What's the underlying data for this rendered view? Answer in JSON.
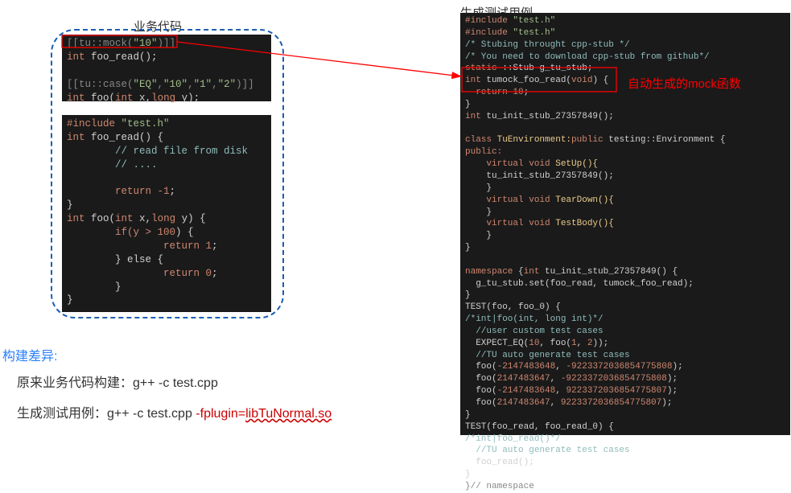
{
  "titles": {
    "left": "业务代码",
    "right": "生成测试用例"
  },
  "labels": {
    "mock_fn": "自动生成的mock函数",
    "build_diff": "构建差异:",
    "build_line1_prefix": "原来业务代码构建：",
    "build_line1_cmd": "g++ -c test.cpp",
    "build_line2_prefix": "生成测试用例：",
    "build_line2_cmd": "g++ -c test.cpp ",
    "build_line2_plugin_a": "-fplugin=",
    "build_line2_plugin_b": "libTuNormal.so"
  },
  "code_top": {
    "l1a": "[[tu::mock(",
    "l1b": "\"10\"",
    "l1c": ")]]",
    "l2a": "int",
    "l2b": " foo_read();",
    "l3": "",
    "l4a": "[[tu::case(",
    "l4b": "\"EQ\"",
    "l4c": ",",
    "l4d": "\"10\"",
    "l4e": ",",
    "l4f": "\"1\"",
    "l4g": ",",
    "l4h": "\"2\"",
    "l4i": ")]]",
    "l5a": "int",
    "l5b": " foo(",
    "l5c": "int",
    "l5d": " x,",
    "l5e": "long",
    "l5f": " y);"
  },
  "code_mid": {
    "l1a": "#include ",
    "l1b": "\"test.h\"",
    "l2a": "int",
    "l2b": " foo_read() {",
    "l3": "        // read file from disk",
    "l4": "        // ....",
    "l5": "",
    "l6a": "        return ",
    "l6b": "-1",
    "l6c": ";",
    "l7": "}",
    "l8a": "int",
    "l8b": " foo(",
    "l8c": "int",
    "l8d": " x,",
    "l8e": "long",
    "l8f": " y) {",
    "l9a": "        if(y > ",
    "l9b": "100",
    "l9c": ") {",
    "l10a": "                return ",
    "l10b": "1",
    "l10c": ";",
    "l11": "        } else {",
    "l12a": "                return ",
    "l12b": "0",
    "l12c": ";",
    "l13": "        }",
    "l14": "}"
  },
  "code_right": {
    "l1a": "#include ",
    "l1b": "\"test.h\"",
    "l2a": "#include ",
    "l2b": "\"test.h\"",
    "l3": "/* Stubing throught cpp-stub */",
    "l4": "/* You need to download cpp-stub from github*/",
    "l5a": "static ",
    "l5b": "::Stub g_tu_stub;",
    "l6a": "int",
    "l6b": " tumock_foo_read(",
    "l6c": "void",
    "l6d": ") {",
    "l7a": "  return ",
    "l7b": "10",
    "l7c": ";",
    "l8": "}",
    "l9a": "int",
    "l9b": " tu_init_stub_27357849();",
    "l10": "",
    "l11a": "class ",
    "l11b": "TuEnvironment:",
    "l11c": "public ",
    "l11d": "testing::Environment {",
    "l12": "public:",
    "l13a": "    virtual void ",
    "l13b": "SetUp(){",
    "l14": "    tu_init_stub_27357849();",
    "l15": "    }",
    "l16a": "    virtual void ",
    "l16b": "TearDown(){",
    "l17": "    }",
    "l18a": "    virtual void ",
    "l18b": "TestBody(){",
    "l19": "    }",
    "l20": "}",
    "l21": "",
    "l22a": "namespace ",
    "l22b": "{",
    "l22c": "int",
    "l22d": " tu_init_stub_27357849() {",
    "l23": "  g_tu_stub.set(foo_read, tumock_foo_read);",
    "l24": "}",
    "l25": "TEST(foo, foo_0) {",
    "l26": "/*int|foo(int, long int)*/",
    "l27": "  //user custom test cases",
    "l28a": "  EXPECT_EQ(",
    "l28b": "10",
    "l28c": ", foo(",
    "l28d": "1",
    "l28e": ", ",
    "l28f": "2",
    "l28g": "));",
    "l29": "  //TU auto generate test cases",
    "l30a": "  foo(",
    "l30b": "-2147483648",
    "l30c": ", ",
    "l30d": "-9223372036854775808",
    "l30e": ");",
    "l31a": "  foo(",
    "l31b": "2147483647",
    "l31c": ", ",
    "l31d": "-9223372036854775808",
    "l31e": ");",
    "l32a": "  foo(",
    "l32b": "-2147483648",
    "l32c": ", ",
    "l32d": "9223372036854775807",
    "l32e": ");",
    "l33a": "  foo(",
    "l33b": "2147483647",
    "l33c": ", ",
    "l33d": "9223372036854775807",
    "l33e": ");",
    "l34": "}",
    "l35": "TEST(foo_read, foo_read_0) {",
    "l36": "/*int|foo_read()*/",
    "l37": "  //TU auto generate test cases",
    "l38": "  foo_read();",
    "l39": "}",
    "l40": "}// namespace"
  }
}
